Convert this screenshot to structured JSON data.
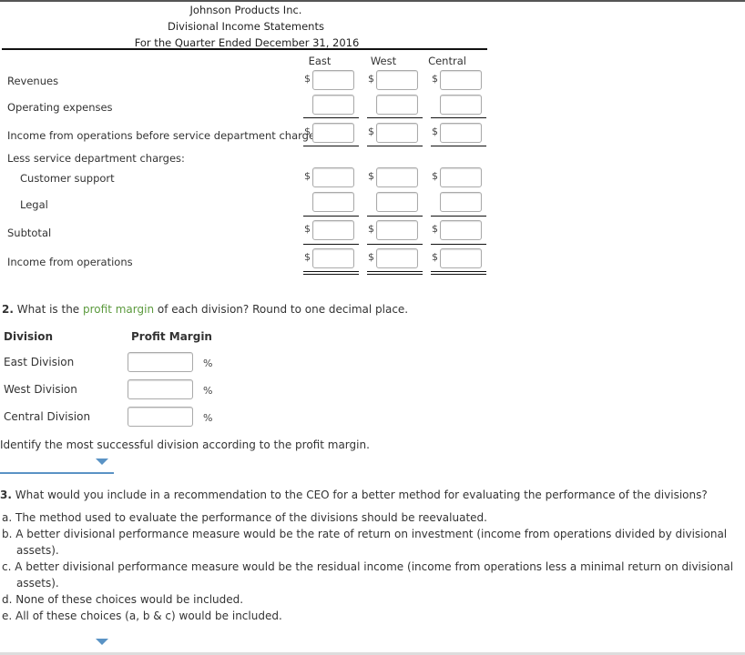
{
  "statement": {
    "company": "Johnson Products Inc.",
    "title": "Divisional Income Statements",
    "period": "For the Quarter Ended December 31, 2016",
    "columns": [
      "East",
      "West",
      "Central"
    ],
    "rows": [
      {
        "label": "Revenues",
        "dollar": true
      },
      {
        "label": "Operating expenses",
        "dollar": false
      },
      {
        "label": "Income from operations before service department charges",
        "dollar": true
      },
      {
        "label": "Less service department charges:"
      },
      {
        "label": "Customer support",
        "dollar": true
      },
      {
        "label": "Legal",
        "dollar": false
      },
      {
        "label": "Subtotal",
        "dollar": true
      },
      {
        "label": "Income from operations",
        "dollar": true
      }
    ],
    "currency_symbol": "$",
    "values": {
      "revenues": [
        "",
        "",
        ""
      ],
      "operating_expenses": [
        "",
        "",
        ""
      ],
      "income_before_service": [
        "",
        "",
        ""
      ],
      "customer_support": [
        "",
        "",
        ""
      ],
      "legal": [
        "",
        "",
        ""
      ],
      "subtotal": [
        "",
        "",
        ""
      ],
      "income_from_operations": [
        "",
        "",
        ""
      ]
    }
  },
  "q2": {
    "number": "2.",
    "text_before": "What is the ",
    "link_text": "profit margin",
    "text_after": " of each division? Round to one decimal place.",
    "col_division": "Division",
    "col_margin": "Profit Margin",
    "percent_symbol": "%",
    "divisions": [
      {
        "label": "East Division",
        "value": ""
      },
      {
        "label": "West Division",
        "value": ""
      },
      {
        "label": "Central Division",
        "value": ""
      }
    ],
    "identify_text": "Identify the most successful division according to the profit margin.",
    "identify_selected": ""
  },
  "q3": {
    "number": "3.",
    "text": "What would you include in a recommendation to the CEO for a better method for evaluating the performance of the divisions?",
    "options": [
      {
        "line1": "a. The method used to evaluate the performance of the divisions should be reevaluated."
      },
      {
        "line1": "b. A better divisional performance measure would be the rate of return on investment (income from operations divided by divisional",
        "line2": "assets)."
      },
      {
        "line1": "c. A better divisional performance measure would be the residual income (income from operations less a minimal return on divisional",
        "line2": "assets)."
      },
      {
        "line1": "d. None of these choices would be included."
      },
      {
        "line1": "e. All of these choices (a, b & c) would be included."
      }
    ],
    "selected": ""
  }
}
